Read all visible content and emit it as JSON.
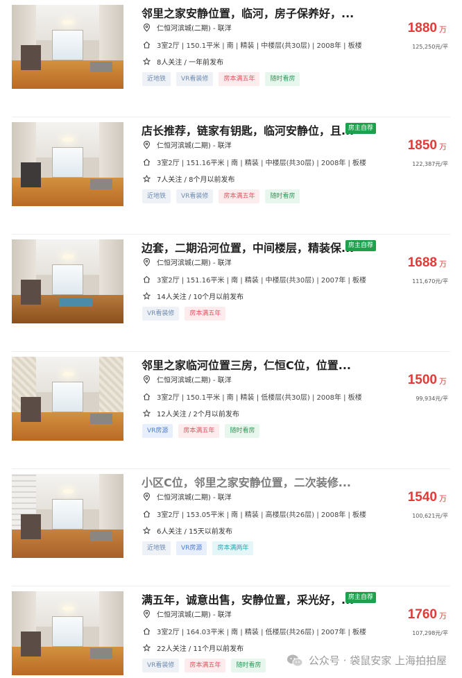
{
  "listings": [
    {
      "title": "邻里之家安静位置，临河，房子保养好，...",
      "title_dim": false,
      "owner_badge": "",
      "location": "仁恒河滨城(二期) - 联洋",
      "details": "3室2厅 | 150.1平米 | 南 | 精装 | 中楼层(共30层) | 2008年 | 板楼",
      "followers": "8人关注 / 一年前发布",
      "tags": [
        {
          "label": "近地铁",
          "style": "gray"
        },
        {
          "label": "VR看装修",
          "style": "gray"
        },
        {
          "label": "房本满五年",
          "style": "red"
        },
        {
          "label": "随时看房",
          "style": "green"
        }
      ],
      "price": "1880",
      "price_unit": "万",
      "unit_price": "125,250元/平"
    },
    {
      "title": "店长推荐，链家有钥匙，临河安静位，且...",
      "title_dim": false,
      "owner_badge": "房主自荐",
      "location": "仁恒河滨城(二期) - 联洋",
      "details": "3室2厅 | 151.16平米 | 南 | 精装 | 中楼层(共30层) | 2008年 | 板楼",
      "followers": "7人关注 / 8个月以前发布",
      "tags": [
        {
          "label": "近地铁",
          "style": "gray"
        },
        {
          "label": "VR看装修",
          "style": "gray"
        },
        {
          "label": "房本满五年",
          "style": "red"
        },
        {
          "label": "随时看房",
          "style": "green"
        }
      ],
      "price": "1850",
      "price_unit": "万",
      "unit_price": "122,387元/平"
    },
    {
      "title": "边套，二期沿河位置，中间楼层，精装保...",
      "title_dim": false,
      "owner_badge": "房主自荐",
      "location": "仁恒河滨城(二期) - 联洋",
      "details": "3室2厅 | 151.16平米 | 南 | 精装 | 中楼层(共30层) | 2007年 | 板楼",
      "followers": "14人关注 / 10个月以前发布",
      "tags": [
        {
          "label": "VR看装修",
          "style": "gray"
        },
        {
          "label": "房本满五年",
          "style": "red"
        }
      ],
      "price": "1688",
      "price_unit": "万",
      "unit_price": "111,670元/平"
    },
    {
      "title": "邻里之家临河位置三房，仁恒C位，位置...",
      "title_dim": false,
      "owner_badge": "",
      "location": "仁恒河滨城(二期) - 联洋",
      "details": "3室2厅 | 150.1平米 | 南 | 精装 | 低楼层(共30层) | 2008年 | 板楼",
      "followers": "12人关注 / 2个月以前发布",
      "tags": [
        {
          "label": "VR房源",
          "style": "blue"
        },
        {
          "label": "房本满五年",
          "style": "red"
        },
        {
          "label": "随时看房",
          "style": "green"
        }
      ],
      "price": "1500",
      "price_unit": "万",
      "unit_price": "99,934元/平"
    },
    {
      "title": "小区C位，邻里之家安静位置，二次装修...",
      "title_dim": true,
      "owner_badge": "",
      "location": "仁恒河滨城(二期) - 联洋",
      "details": "3室2厅 | 153.05平米 | 南 | 精装 | 高楼层(共26层) | 2008年 | 板楼",
      "followers": "6人关注 / 15天以前发布",
      "tags": [
        {
          "label": "近地铁",
          "style": "gray"
        },
        {
          "label": "VR房源",
          "style": "blue"
        },
        {
          "label": "房本满两年",
          "style": "teal"
        }
      ],
      "price": "1540",
      "price_unit": "万",
      "unit_price": "100,621元/平"
    },
    {
      "title": "满五年，诚意出售，安静位置，采光好，...",
      "title_dim": false,
      "owner_badge": "房主自荐",
      "location": "仁恒河滨城(二期) - 联洋",
      "details": "3室2厅 | 164.03平米 | 南 | 精装 | 低楼层(共26层) | 2007年 | 板楼",
      "followers": "22人关注 / 11个月以前发布",
      "tags": [
        {
          "label": "VR看装修",
          "style": "gray"
        },
        {
          "label": "房本满五年",
          "style": "red"
        },
        {
          "label": "随时看房",
          "style": "green"
        }
      ],
      "price": "1760",
      "price_unit": "万",
      "unit_price": "107,298元/平"
    }
  ],
  "watermark": {
    "text": "公众号 · 袋鼠安家 上海拍拍屋",
    "icon": "wechat-icon"
  },
  "icons": {
    "location": "location-pin-icon",
    "layout": "house-icon",
    "followers": "star-icon"
  },
  "colors": {
    "price": "#e03b36",
    "owner_badge": "#1ea04c",
    "title": "#1f1f1f"
  }
}
